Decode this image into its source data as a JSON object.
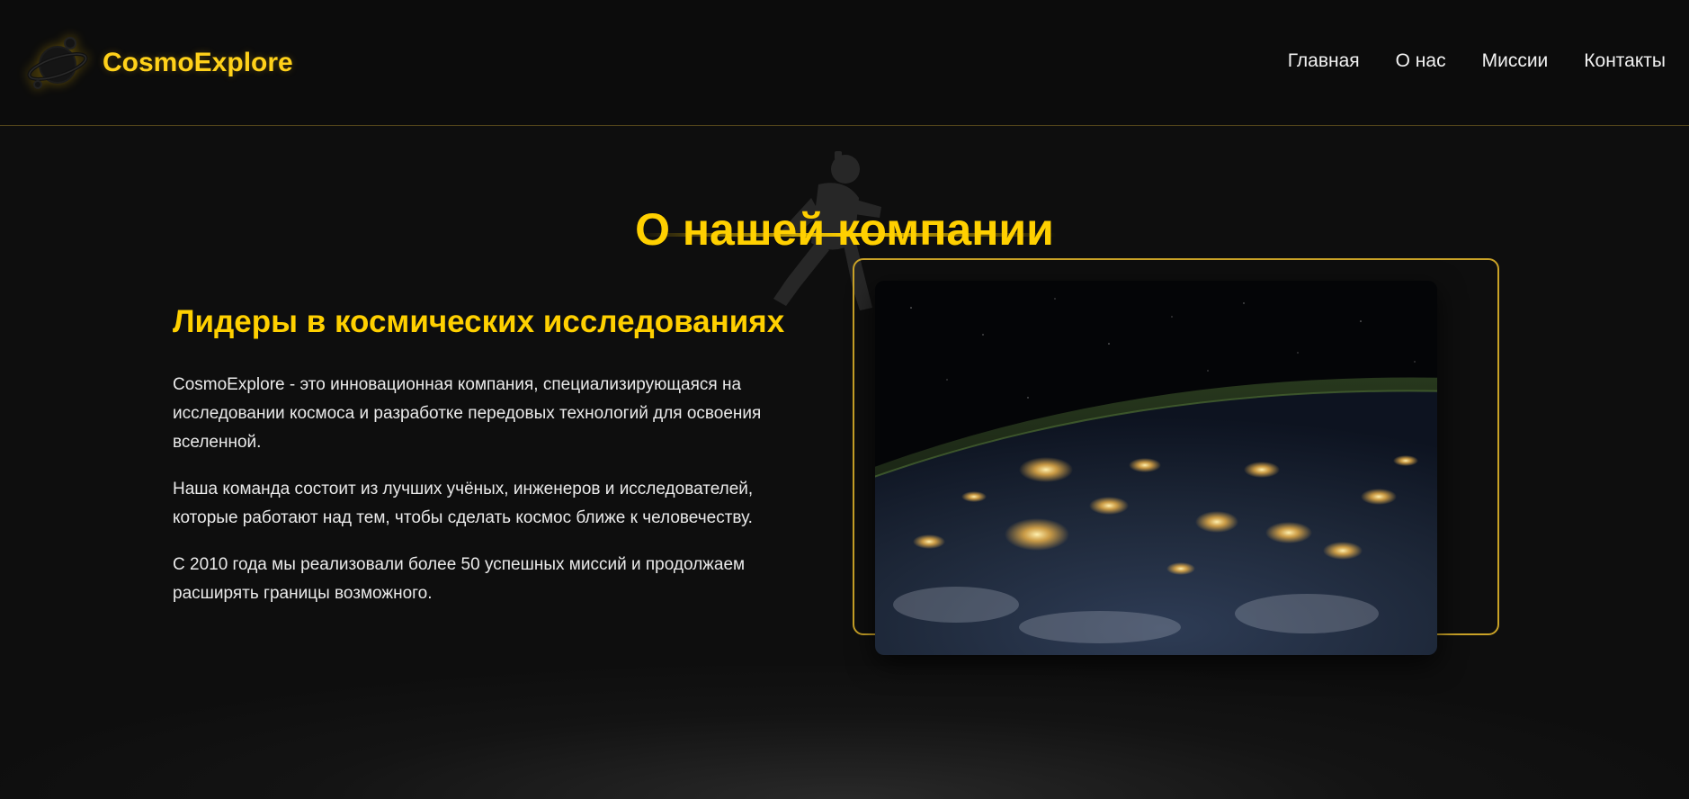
{
  "header": {
    "brand": "CosmoExplore",
    "logo_icon": "planet-icon",
    "nav": [
      {
        "label": "Главная"
      },
      {
        "label": "О нас"
      },
      {
        "label": "Миссии"
      },
      {
        "label": "Контакты"
      }
    ]
  },
  "about": {
    "title": "О нашей компании",
    "subheading": "Лидеры в космических исследованиях",
    "paragraphs": [
      "CosmoExplore - это инновационная компания, специализирующаяся на исследовании космоса и разработке передовых технологий для освоения вселенной.",
      "Наша команда состоит из лучших учёных, инженеров и исследователей, которые работают над тем, чтобы сделать космос ближе к человечеству.",
      "С 2010 года мы реализовали более 50 успешных миссий и продолжаем расширять границы возможного."
    ],
    "image_icon": "earth-at-night-image",
    "decoration_icon": "astronaut-icon"
  },
  "colors": {
    "accent": "#ffd000",
    "frame": "#c9a227",
    "background": "#0e0e0e",
    "text": "#eaeaea"
  }
}
